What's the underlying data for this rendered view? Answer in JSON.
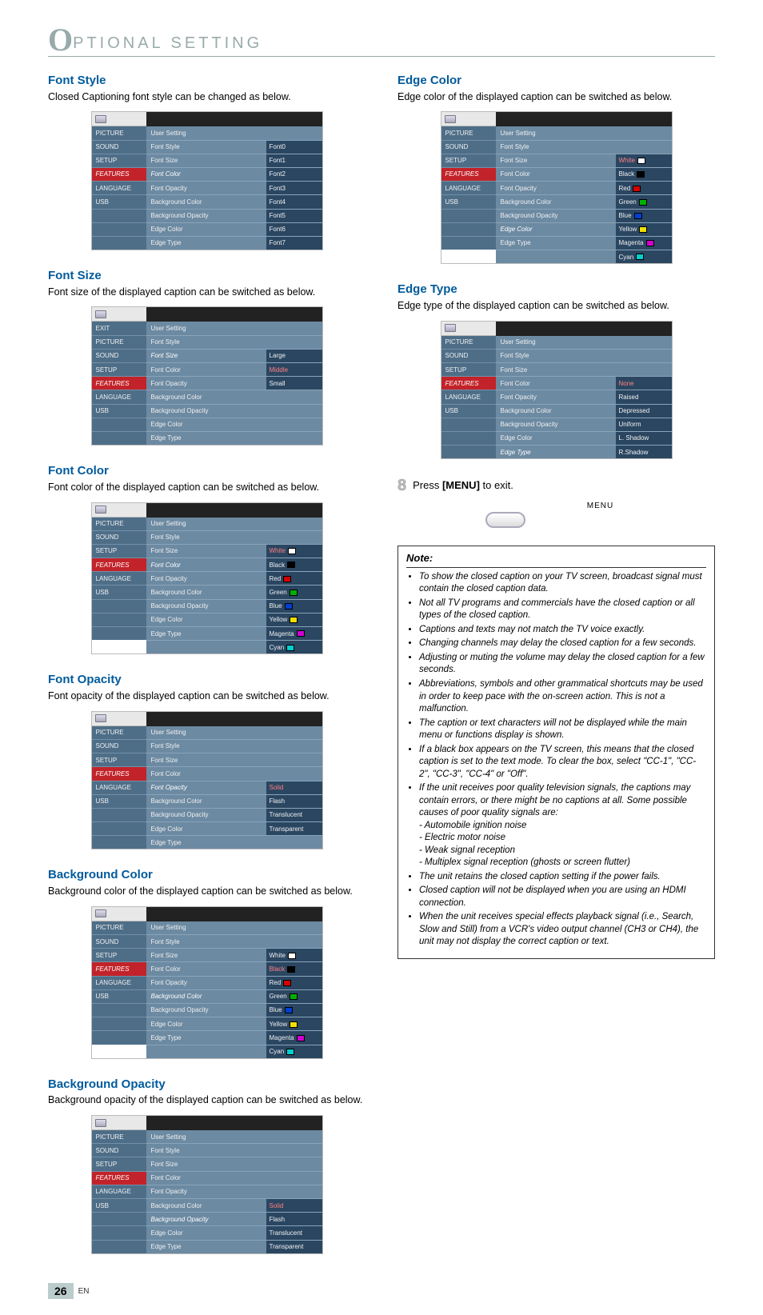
{
  "header": {
    "big_letter": "O",
    "rest": "PTIONAL  SETTING"
  },
  "page_number": "26",
  "page_lang": "EN",
  "osd_common_sidebar": [
    "PICTURE",
    "SOUND",
    "SETUP",
    "FEATURES",
    "LANGUAGE",
    "USB"
  ],
  "osd_rows": [
    "User Setting",
    "Font Style",
    "Font Size",
    "Font Color",
    "Font Opacity",
    "Background Color",
    "Background Opacity",
    "Edge Color",
    "Edge Type"
  ],
  "fontStyle": {
    "heading": "Font Style",
    "desc": "Closed Captioning font style can be changed as below.",
    "active_sidebar": 3,
    "vals": [
      "",
      "Font0",
      "Font1",
      "Font2",
      "Font3",
      "Font4",
      "Font5",
      "Font6",
      "Font7"
    ],
    "hl_row": 3
  },
  "fontSize": {
    "heading": "Font Size",
    "desc": "Font size of the displayed caption can be switched as below.",
    "sidebar": [
      "EXIT",
      "PICTURE",
      "SOUND",
      "SETUP",
      "FEATURES",
      "LANGUAGE",
      "USB"
    ],
    "active_sidebar": 4,
    "vals": [
      "",
      "",
      "Large",
      "Middle",
      "Small",
      "",
      "",
      "",
      ""
    ],
    "hl_row": 2,
    "red_idx": 3
  },
  "fontColor": {
    "heading": "Font Color",
    "desc": "Font color of the displayed caption can be switched as below.",
    "active_sidebar": 3,
    "vals": [
      "",
      "",
      "White",
      "Black",
      "Red",
      "Green",
      "Blue",
      "Yellow",
      "Magenta",
      "Cyan"
    ],
    "swatches": [
      "",
      "",
      "#ffffff",
      "#000000",
      "#d40000",
      "#00b000",
      "#0040d0",
      "#f0e000",
      "#d000d0",
      "#00d0d0"
    ],
    "hl_row": 3,
    "red_idx": 2
  },
  "fontOpacity": {
    "heading": "Font Opacity",
    "desc": "Font opacity of the displayed caption can be switched as below.",
    "active_sidebar": 3,
    "vals": [
      "",
      "",
      "",
      "",
      "Solid",
      "Flash",
      "Translucent",
      "Transparent",
      ""
    ],
    "hl_row": 4,
    "red_idx": 4
  },
  "bgColor": {
    "heading": "Background Color",
    "desc": "Background color of the displayed caption can be switched as below.",
    "active_sidebar": 3,
    "vals": [
      "",
      "",
      "White",
      "Black",
      "Red",
      "Green",
      "Blue",
      "Yellow",
      "Magenta",
      "Cyan"
    ],
    "swatches": [
      "",
      "",
      "#ffffff",
      "#000000",
      "#d40000",
      "#00b000",
      "#0040d0",
      "#f0e000",
      "#d000d0",
      "#00d0d0"
    ],
    "hl_row": 5,
    "red_idx": 3
  },
  "bgOpacity": {
    "heading": "Background Opacity",
    "desc": "Background opacity of the displayed caption can be switched as below.",
    "active_sidebar": 3,
    "vals": [
      "",
      "",
      "",
      "",
      "",
      "Solid",
      "Flash",
      "Translucent",
      "Transparent"
    ],
    "hl_row": 6,
    "red_idx": 5
  },
  "edgeColor": {
    "heading": "Edge Color",
    "desc": "Edge color of the displayed caption can be switched as below.",
    "active_sidebar": 3,
    "vals": [
      "",
      "",
      "White",
      "Black",
      "Red",
      "Green",
      "Blue",
      "Yellow",
      "Magenta",
      "Cyan"
    ],
    "swatches": [
      "",
      "",
      "#ffffff",
      "#000000",
      "#d40000",
      "#00b000",
      "#0040d0",
      "#f0e000",
      "#d000d0",
      "#00d0d0"
    ],
    "hl_row": 7,
    "red_idx": 2
  },
  "edgeType": {
    "heading": "Edge Type",
    "desc": "Edge type of the displayed caption can be switched as below.",
    "active_sidebar": 3,
    "vals": [
      "",
      "",
      "",
      "None",
      "Raised",
      "Depressed",
      "Uniform",
      "L. Shadow",
      "R.Shadow"
    ],
    "hl_row": 8,
    "red_idx": 3
  },
  "step8": {
    "num": "8",
    "text_pre": "Press ",
    "btn": "[MENU]",
    "text_post": " to exit.",
    "menu_label": "MENU"
  },
  "note": {
    "title": "Note:",
    "items": [
      "To show the closed caption on your TV screen, broadcast signal must contain the closed caption data.",
      "Not all TV programs and commercials have the closed caption or all types of the closed caption.",
      "Captions and texts may not match the TV voice exactly.",
      "Changing channels may delay the closed caption for a few seconds.",
      "Adjusting or muting the volume may delay the closed caption for a few seconds.",
      "Abbreviations, symbols and other grammatical shortcuts may be used in order to keep pace with the on-screen action. This is not a malfunction.",
      "The caption or text characters will not be displayed while the main menu or functions display is shown.",
      "If a black box appears on the TV screen, this means that the closed caption is set to the text mode. To clear the box, select \"CC-1\", \"CC-2\", \"CC-3\", \"CC-4\" or \"Off\".",
      "If the unit receives poor quality television signals, the captions may contain errors, or there might be no captions at all. Some possible causes of poor quality signals are:",
      "The unit retains the closed caption setting if the power fails.",
      "Closed caption will not be displayed when you are using an HDMI connection.",
      "When the unit receives special effects playback signal (i.e., Search, Slow and Still) from a VCR's video output channel (CH3 or CH4), the unit may not display the correct caption or text."
    ],
    "sub_items": [
      "- Automobile ignition noise",
      "- Electric motor noise",
      "- Weak signal reception",
      "- Multiplex signal reception (ghosts or screen flutter)"
    ]
  }
}
